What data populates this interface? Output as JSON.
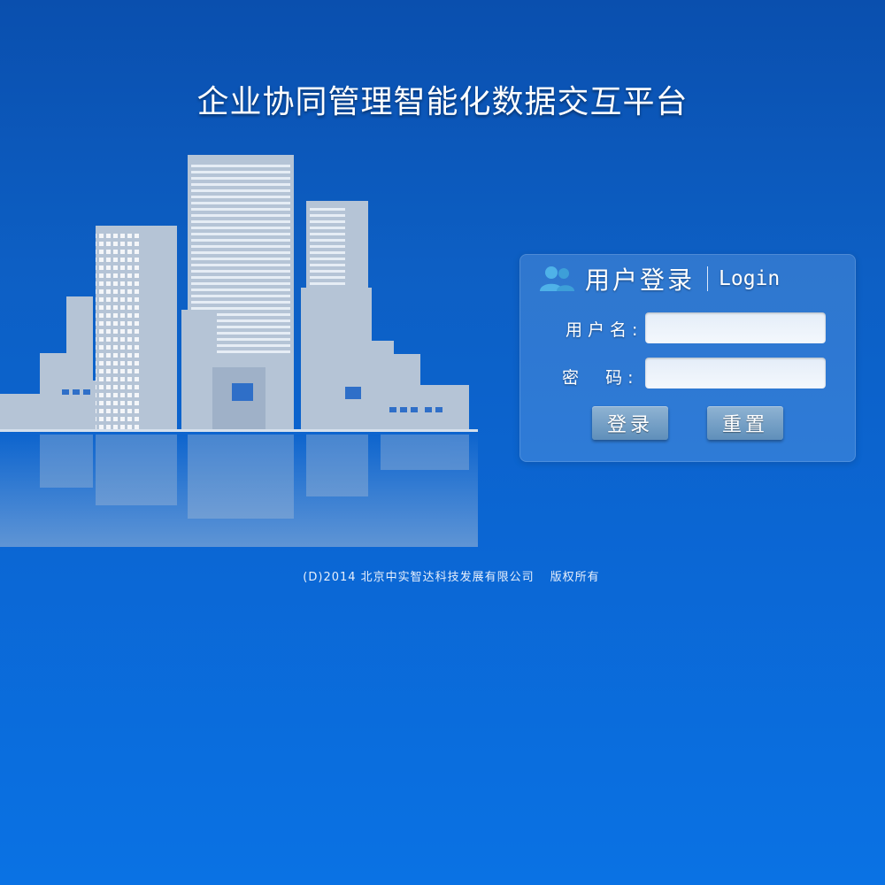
{
  "title": "企业协同管理智能化数据交互平台",
  "login": {
    "heading_cn": "用户登录",
    "heading_en": "Login",
    "username_label": "用户名:",
    "username_value": "",
    "password_label": "密  码:",
    "password_value": "",
    "login_button": "登录",
    "reset_button": "重置"
  },
  "footer": {
    "copyright": "(D)2014 北京中实智达科技发展有限公司",
    "rights": "版权所有"
  },
  "icons": {
    "user_icon": "users-icon",
    "city_graphic": "city-skyline-illustration"
  },
  "colors": {
    "background_top": "#0a4fae",
    "background_bottom": "#0a72e4",
    "building": "#b5c4d6",
    "button": "#6f9ec7",
    "icon": "#4fb2e8"
  }
}
